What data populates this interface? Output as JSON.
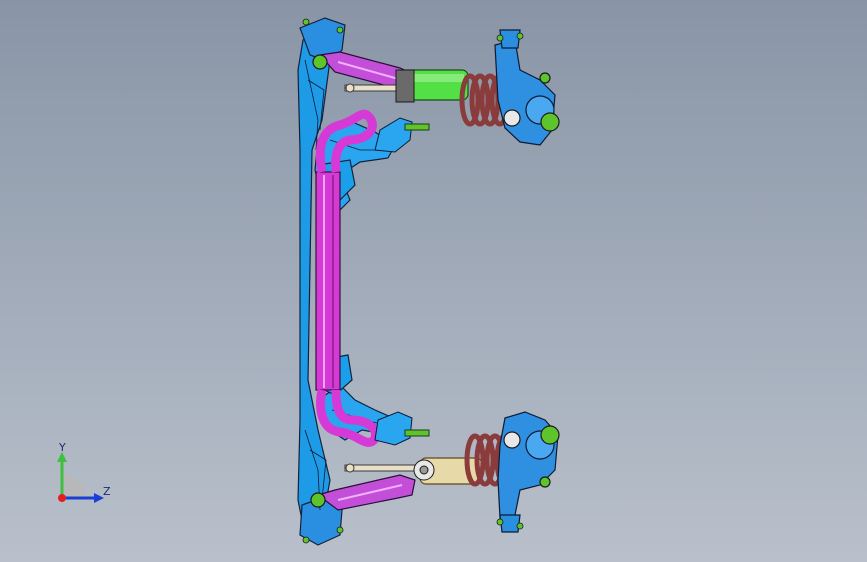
{
  "viewport": {
    "background_top": "#8995a6",
    "background_bottom": "#b9c0cb"
  },
  "model": {
    "description_icon": "front-suspension-assembly",
    "colors": {
      "subframe": "#1e9be6",
      "stabilizer_bar": "#d63ad6",
      "control_arm": "#c34fd9",
      "tie_rod": "#e8e0c8",
      "spring": "#8a3b3b",
      "damper_top": "#52e046",
      "damper_bottom": "#e8d9a8",
      "knuckle": "#2f8fe0",
      "hub": "#5ec42c",
      "outline": "#1a1a1a"
    }
  },
  "triad": {
    "y_label": "Y",
    "z_label": "Z",
    "colors": {
      "y": "#3fbf3f",
      "z": "#1a3fd6",
      "origin": "#e02020"
    }
  }
}
